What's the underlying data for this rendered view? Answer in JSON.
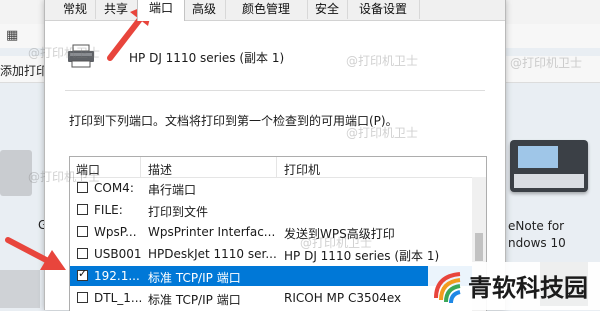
{
  "tabs": [
    "常规",
    "共享",
    "端口",
    "高级",
    "颜色管理",
    "安全",
    "设备设置"
  ],
  "active_tab": "端口",
  "printer_name": "HP DJ 1110 series (副本 1)",
  "instruction": "打印到下列端口。文档将打印到第一个检查到的可用端口(P)。",
  "columns": [
    "端口",
    "描述",
    "打印机"
  ],
  "ports": [
    {
      "port": "COM4:",
      "description": "串行端口",
      "printer": "",
      "checked": false,
      "selected": false
    },
    {
      "port": "FILE:",
      "description": "打印到文件",
      "printer": "",
      "checked": false,
      "selected": false
    },
    {
      "port": "WpsP...",
      "description": "WpsPrinter Interfac...",
      "printer": "发送到WPS高级打印",
      "checked": false,
      "selected": false
    },
    {
      "port": "USB001",
      "description": "HPDeskJet 1110 ser...",
      "printer": "HP DJ 1110 series (副本 1)",
      "checked": false,
      "selected": false
    },
    {
      "port": "192.1...",
      "description": "标准 TCP/IP 端口",
      "printer": "",
      "checked": true,
      "selected": true
    },
    {
      "port": "DTL_1...",
      "description": "标准 TCP/IP 端口",
      "printer": "RICOH MP C3504ex",
      "checked": false,
      "selected": false
    }
  ],
  "background": {
    "add_printer": "添加打印",
    "right_label_1": "eNote for",
    "right_label_2": "ndows 10",
    "left_label": "G"
  },
  "watermark": "@打印机卫士",
  "brand": "青软科技园",
  "colors": {
    "selection": "#0078d7",
    "arrow": "#e8453c"
  }
}
